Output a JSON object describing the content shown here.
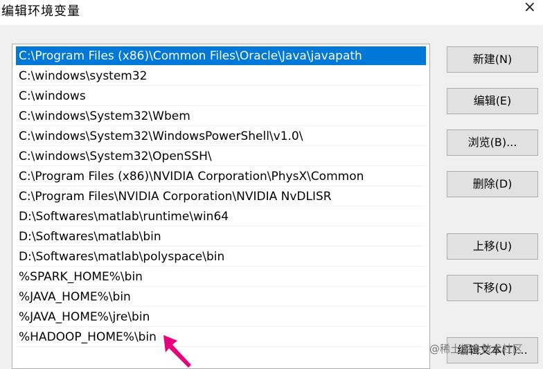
{
  "window": {
    "title": "编辑环境变量",
    "close_glyph": "×"
  },
  "path_list": {
    "items": [
      "C:\\Program Files (x86)\\Common Files\\Oracle\\Java\\javapath",
      "C:\\windows\\system32",
      "C:\\windows",
      "C:\\windows\\System32\\Wbem",
      "C:\\windows\\System32\\WindowsPowerShell\\v1.0\\",
      "C:\\windows\\System32\\OpenSSH\\",
      "C:\\Program Files (x86)\\NVIDIA Corporation\\PhysX\\Common",
      "C:\\Program Files\\NVIDIA Corporation\\NVIDIA NvDLISR",
      "D:\\Softwares\\matlab\\runtime\\win64",
      "D:\\Softwares\\matlab\\bin",
      "D:\\Softwares\\matlab\\polyspace\\bin",
      "%SPARK_HOME%\\bin",
      "%JAVA_HOME%\\bin",
      "%JAVA_HOME%\\jre\\bin",
      "%HADOOP_HOME%\\bin"
    ],
    "selected_index": 0
  },
  "buttons": {
    "new": "新建(N)",
    "edit": "编辑(E)",
    "browse": "浏览(B)...",
    "delete": "删除(D)",
    "move_up": "上移(U)",
    "move_down": "下移(O)",
    "edit_text": "编辑文本(T)..."
  },
  "annotation": {
    "arrow_color": "#e6007e"
  },
  "colors": {
    "selection": "#0078d7",
    "dialog_bg": "#f0f0f0"
  },
  "watermark": "@稀土掘金技术社区"
}
